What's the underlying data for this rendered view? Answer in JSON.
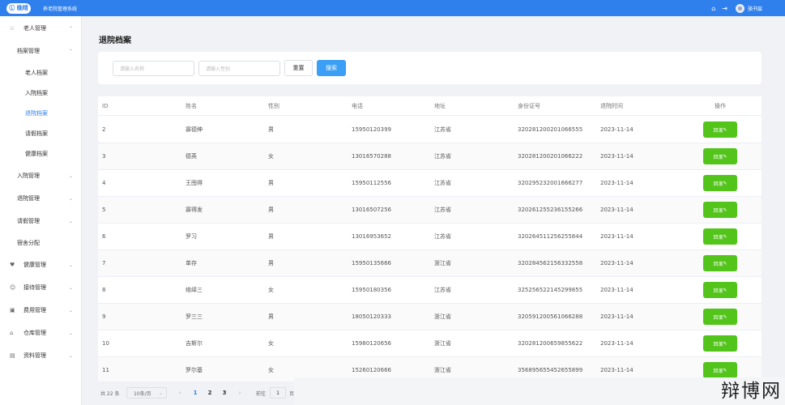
{
  "header": {
    "logo": "Ⓛ 晚晴",
    "system_title": "养老院管理系统",
    "home_icon": "home-icon",
    "logout_icon": "logout-icon",
    "user_name": "骆书宸",
    "bg_color": "#2f80ed"
  },
  "sidebar": {
    "items": [
      {
        "label": "老人管理",
        "icon": "elder-icon",
        "glyph": "♘",
        "chevron": "⌃",
        "indent": 0
      },
      {
        "label": "档案管理",
        "chevron": "⌃",
        "indent": 1
      },
      {
        "label": "老人档案",
        "indent": 2
      },
      {
        "label": "入院档案",
        "indent": 2
      },
      {
        "label": "退院档案",
        "indent": 2,
        "active": true
      },
      {
        "label": "请假档案",
        "indent": 2
      },
      {
        "label": "健康档案",
        "indent": 2
      },
      {
        "label": "入院管理",
        "chevron": "⌄",
        "indent": 1
      },
      {
        "label": "退院管理",
        "chevron": "⌄",
        "indent": 1
      },
      {
        "label": "请假管理",
        "chevron": "⌄",
        "indent": 1
      },
      {
        "label": "宿舍分配",
        "indent": 1
      },
      {
        "label": "健康管理",
        "icon": "health-icon",
        "glyph": "♥",
        "chevron": "⌄",
        "indent": 0
      },
      {
        "label": "接待管理",
        "icon": "reception-icon",
        "glyph": "☺",
        "chevron": "⌄",
        "indent": 0
      },
      {
        "label": "费用管理",
        "icon": "fee-icon",
        "glyph": "▣",
        "chevron": "⌄",
        "indent": 0
      },
      {
        "label": "仓库管理",
        "icon": "warehouse-icon",
        "glyph": "⌂",
        "chevron": "⌄",
        "indent": 0
      },
      {
        "label": "资料管理",
        "icon": "document-icon",
        "glyph": "▤",
        "chevron": "⌄",
        "indent": 0
      }
    ],
    "active_color": "#2f80ed"
  },
  "page_title": "退院档案",
  "search": {
    "name_placeholder": "请输入名称",
    "gender_placeholder": "请输入性别",
    "reset_label": "重置",
    "search_label": "搜索"
  },
  "table": {
    "columns": [
      "ID",
      "姓名",
      "性别",
      "电话",
      "地址",
      "身份证号",
      "退院时间",
      "操作"
    ],
    "rows": [
      {
        "id": "2",
        "name": "寡德绅",
        "gender": "男",
        "phone": "15950120399",
        "address": "江苏省",
        "id_card": "320281200201066555",
        "time": "2023-11-14"
      },
      {
        "id": "3",
        "name": "德英",
        "gender": "女",
        "phone": "13016570288",
        "address": "江苏省",
        "id_card": "320281200201066222",
        "time": "2023-11-14"
      },
      {
        "id": "4",
        "name": "王囤得",
        "gender": "男",
        "phone": "15950112556",
        "address": "江苏省",
        "id_card": "320295232001666277",
        "time": "2023-11-14"
      },
      {
        "id": "5",
        "name": "寡得发",
        "gender": "男",
        "phone": "13016507256",
        "address": "江苏省",
        "id_card": "320261255236155266",
        "time": "2023-11-14"
      },
      {
        "id": "6",
        "name": "罗习",
        "gender": "男",
        "phone": "13016953652",
        "address": "江苏省",
        "id_card": "320264511256255844",
        "time": "2023-11-14"
      },
      {
        "id": "7",
        "name": "单存",
        "gender": "男",
        "phone": "15950135666",
        "address": "浙江省",
        "id_card": "320284562156332558",
        "time": "2023-11-14"
      },
      {
        "id": "8",
        "name": "络绎三",
        "gender": "女",
        "phone": "15950180356",
        "address": "江苏省",
        "id_card": "325256522145299855",
        "time": "2023-11-14"
      },
      {
        "id": "9",
        "name": "罗三三",
        "gender": "男",
        "phone": "18050120333",
        "address": "浙江省",
        "id_card": "320591200561066288",
        "time": "2023-11-14"
      },
      {
        "id": "10",
        "name": "吉斯尔",
        "gender": "女",
        "phone": "15980120656",
        "address": "浙江省",
        "id_card": "320281200659855622",
        "time": "2023-11-14"
      },
      {
        "id": "11",
        "name": "罗尔基",
        "gender": "女",
        "phone": "15260120666",
        "address": "浙江省",
        "id_card": "356895655452655899",
        "time": "2023-11-14"
      }
    ],
    "action_label": "回滚",
    "action_icon": "edit-icon",
    "action_color": "#52c41a"
  },
  "pagination": {
    "total": "共 22 条",
    "page_size": "10条/页",
    "pages": [
      "1",
      "2",
      "3"
    ],
    "current": "1",
    "goto_label": "前往",
    "goto_value": "1",
    "goto_unit": "页"
  },
  "watermark": "辩博网"
}
